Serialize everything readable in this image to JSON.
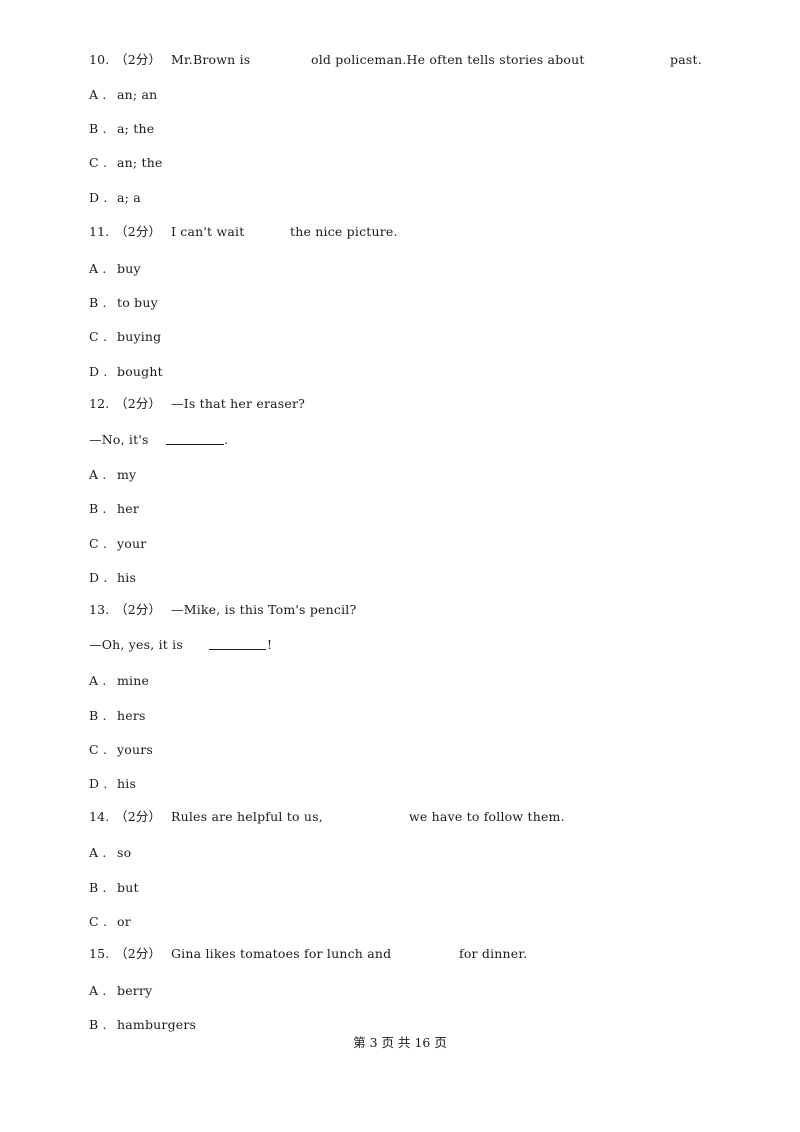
{
  "questions": [
    {
      "number": "10.",
      "score": "（2分）",
      "stem_parts": [
        "Mr.Brown is",
        "old policeman.He often tells stories about",
        "past."
      ],
      "options": [
        {
          "letter": "A .",
          "text": "an; an"
        },
        {
          "letter": "B .",
          "text": "a; the"
        },
        {
          "letter": "C .",
          "text": "an; the"
        },
        {
          "letter": "D .",
          "text": "a; a"
        }
      ]
    },
    {
      "number": "11.",
      "score": "（2分）",
      "stem_parts": [
        "I can't wait",
        "the nice picture."
      ],
      "options": [
        {
          "letter": "A .",
          "text": "buy"
        },
        {
          "letter": "B .",
          "text": "to buy"
        },
        {
          "letter": "C .",
          "text": "buying"
        },
        {
          "letter": "D .",
          "text": "bought"
        }
      ]
    },
    {
      "number": "12.",
      "score": "（2分）",
      "stem": "—Is that her eraser?",
      "answer_line_prefix": "—No, it's ",
      "answer_line_suffix": ".",
      "options": [
        {
          "letter": "A .",
          "text": "my"
        },
        {
          "letter": "B .",
          "text": "her"
        },
        {
          "letter": "C .",
          "text": "your"
        },
        {
          "letter": "D .",
          "text": "his"
        }
      ]
    },
    {
      "number": "13.",
      "score": "（2分）",
      "stem": "—Mike, is this Tom's pencil?",
      "answer_line_prefix": "—Oh, yes, it is ",
      "answer_line_suffix": "!",
      "options": [
        {
          "letter": "A .",
          "text": "mine"
        },
        {
          "letter": "B .",
          "text": "hers"
        },
        {
          "letter": "C .",
          "text": "yours"
        },
        {
          "letter": "D .",
          "text": "his"
        }
      ]
    },
    {
      "number": "14.",
      "score": "（2分）",
      "stem_parts": [
        "Rules are helpful to us,",
        "we have to follow them."
      ],
      "options": [
        {
          "letter": "A .",
          "text": "so"
        },
        {
          "letter": "B .",
          "text": "but"
        },
        {
          "letter": "C .",
          "text": "or"
        }
      ]
    },
    {
      "number": "15.",
      "score": "（2分）",
      "stem_parts": [
        "Gina likes tomatoes for lunch and",
        "for dinner."
      ],
      "options": [
        {
          "letter": "A .",
          "text": "berry"
        },
        {
          "letter": "B .",
          "text": "hamburgers"
        }
      ]
    }
  ],
  "footer": {
    "page_label": "第 3 页 共 16 页"
  }
}
